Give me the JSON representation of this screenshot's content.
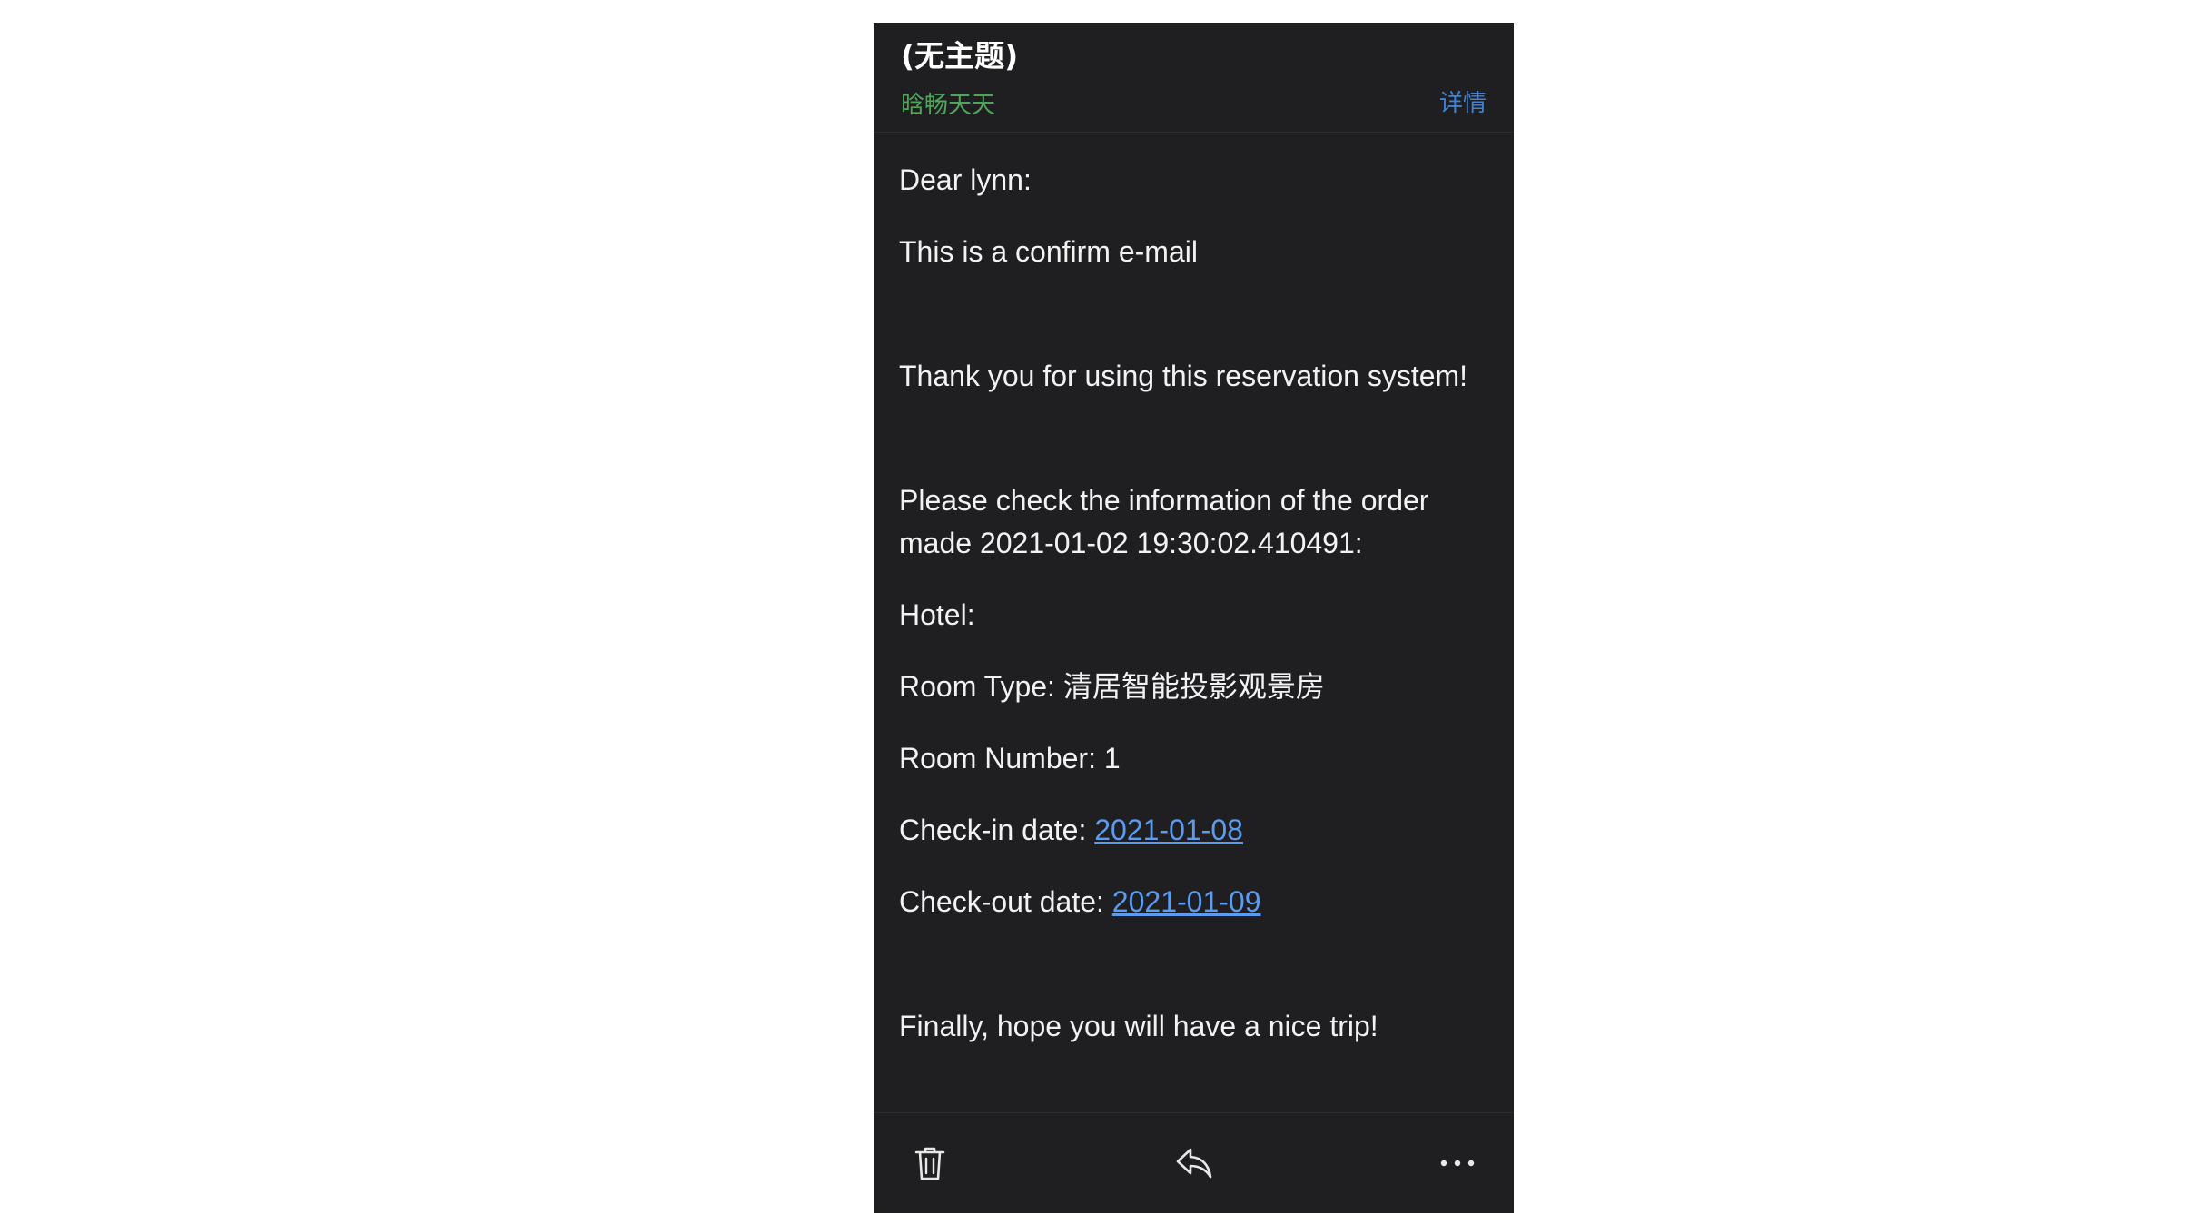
{
  "email": {
    "subject": "(无主题)",
    "sender": "晗畅天天",
    "details_label": "详情"
  },
  "body": {
    "greeting": "Dear lynn:",
    "confirm_line": "This is a confirm e-mail",
    "thanks_line": "Thank you for using this reservation system!",
    "check_line": "Please check the information of the order made 2021-01-02 19:30:02.410491:",
    "hotel_label": "Hotel:",
    "room_type_label": "Room Type: ",
    "room_type_value": "清居智能投影观景房",
    "room_number_line": "Room Number: 1",
    "checkin_label": "Check-in date: ",
    "checkin_date": "2021-01-08",
    "checkout_label": "Check-out date: ",
    "checkout_date": "2021-01-09",
    "closing_line": "Finally, hope you will have a nice trip!"
  },
  "toolbar": {
    "icons": [
      "trash-icon",
      "reply-icon",
      "more-icon"
    ]
  },
  "colors": {
    "background": "#1f1f21",
    "sender": "#4fa55a",
    "details_link": "#3f82d6",
    "date_link": "#5b9bf0"
  }
}
